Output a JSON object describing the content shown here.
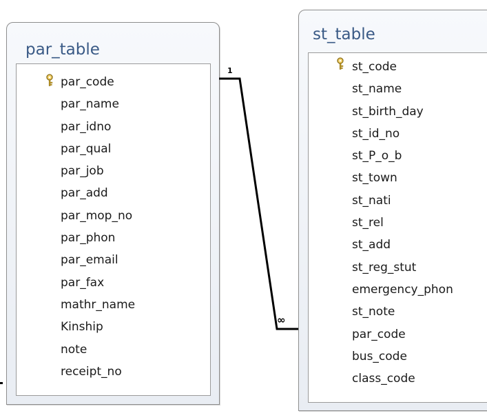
{
  "relationship": {
    "one_label": "1",
    "many_label": "∞"
  },
  "tables": {
    "par_table": {
      "title": "par_table",
      "fields": [
        "par_code",
        "par_name",
        "par_idno",
        "par_qual",
        "par_job",
        "par_add",
        "par_mop_no",
        "par_phon",
        "par_email",
        "par_fax",
        "mathr_name",
        "Kinship",
        "note",
        "receipt_no"
      ]
    },
    "st_table": {
      "title": "st_table",
      "fields": [
        "st_code",
        "st_name",
        "st_birth_day",
        "st_id_no",
        "st_P_o_b",
        "st_town",
        "st_nati",
        "st_rel",
        "st_add",
        "st_reg_stut",
        "emergency_phon",
        "st_note",
        "par_code",
        "bus_code",
        "class_code"
      ]
    }
  },
  "icons": {
    "primary_key": "key-icon"
  },
  "colors": {
    "title": "#3a5a86",
    "window_border": "#8d8d8d",
    "relation_line": "#000000"
  }
}
